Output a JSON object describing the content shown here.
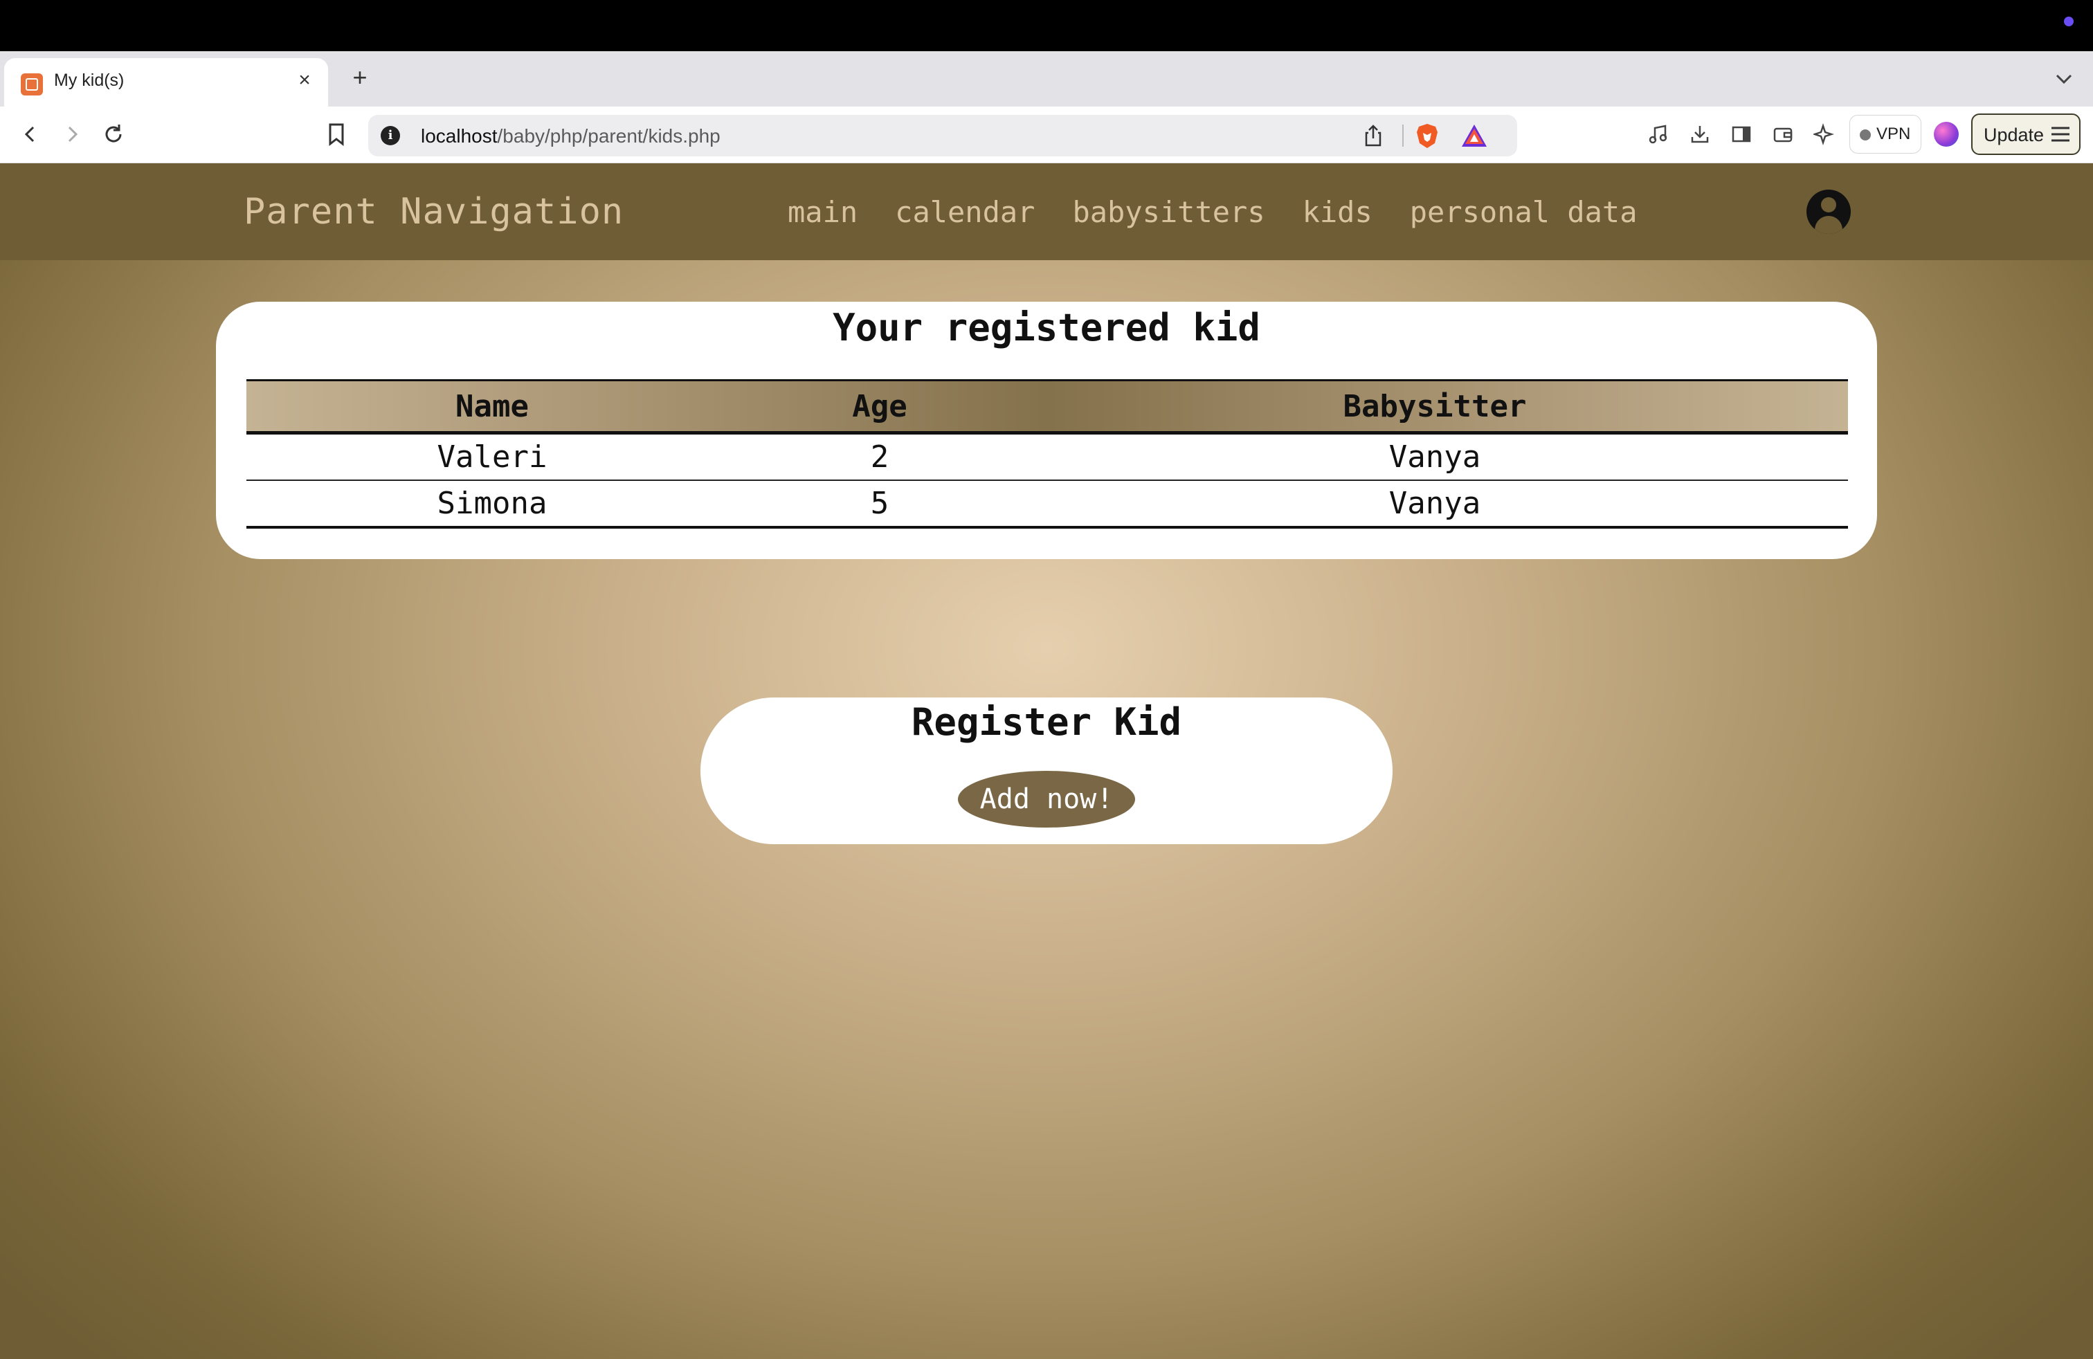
{
  "browser": {
    "tab": {
      "title": "My kid(s)"
    },
    "url": {
      "host": "localhost",
      "path": "/baby/php/parent/kids.php"
    },
    "vpn_label": "VPN",
    "update_label": "Update"
  },
  "nav": {
    "brand": "Parent Navigation",
    "links": [
      "main",
      "calendar",
      "babysitters",
      "kids",
      "personal data"
    ]
  },
  "kids_section": {
    "title": "Your registered kid",
    "columns": [
      "Name",
      "Age",
      "Babysitter"
    ],
    "rows": [
      [
        "Valeri",
        "2",
        "Vanya"
      ],
      [
        "Simona",
        "5",
        "Vanya"
      ]
    ]
  },
  "register_section": {
    "title": "Register Kid",
    "button_label": "Add now!"
  },
  "colors": {
    "nav_background": "#6e5d35",
    "nav_text": "#d8c39e",
    "button_background": "#7a6746",
    "card_background": "#ffffff"
  }
}
